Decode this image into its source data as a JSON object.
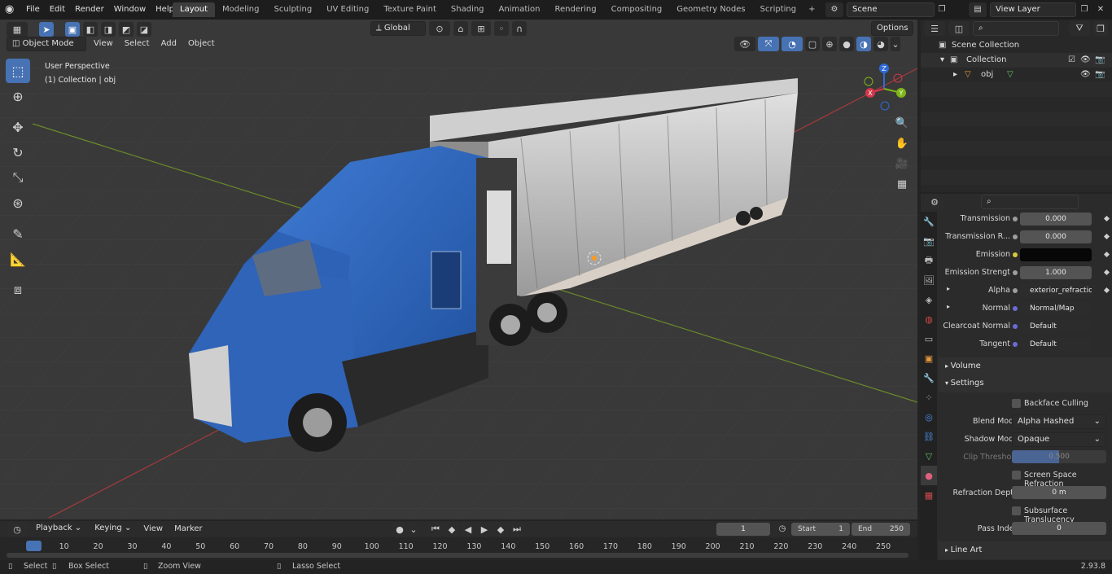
{
  "topbar": {
    "menus": [
      "File",
      "Edit",
      "Render",
      "Window",
      "Help"
    ],
    "workspaces": [
      "Layout",
      "Modeling",
      "Sculpting",
      "UV Editing",
      "Texture Paint",
      "Shading",
      "Animation",
      "Rendering",
      "Compositing",
      "Geometry Nodes",
      "Scripting"
    ],
    "active_workspace": "Layout",
    "add_workspace": "+",
    "scene": "Scene",
    "view_layer": "View Layer"
  },
  "viewport": {
    "mode": "Object Mode",
    "menus": [
      "View",
      "Select",
      "Add",
      "Object"
    ],
    "transform_orientation": "Global",
    "options_label": "Options",
    "perspective_label": "User Perspective",
    "collection_label": "(1) Collection | obj",
    "gizmo": {
      "x": "X",
      "y": "Y",
      "z": "Z"
    }
  },
  "outliner": {
    "scene_collection": "Scene Collection",
    "collection": "Collection",
    "object": "obj"
  },
  "properties": {
    "rows": [
      {
        "label": "Transmission",
        "value": "0.000"
      },
      {
        "label": "Transmission R...",
        "value": "0.000"
      },
      {
        "label": "Emission",
        "value": ""
      },
      {
        "label": "Emission Strengt",
        "value": "1.000"
      },
      {
        "label": "Alpha",
        "value": "exterior_refraction_i..."
      },
      {
        "label": "Normal",
        "value": "Normal/Map"
      },
      {
        "label": "Clearcoat Normal",
        "value": "Default"
      },
      {
        "label": "Tangent",
        "value": "Default"
      }
    ],
    "volume_label": "Volume",
    "settings_label": "Settings",
    "backface_culling": "Backface Culling",
    "blend_mode_label": "Blend Mode",
    "blend_mode": "Alpha Hashed",
    "shadow_mode_label": "Shadow Mode",
    "shadow_mode": "Opaque",
    "clip_threshold_label": "Clip Threshold",
    "clip_threshold": "0.500",
    "ssr_label": "Screen Space Refraction",
    "refraction_depth_label": "Refraction Depth",
    "refraction_depth": "0 m",
    "subsurface_label": "Subsurface Translucency",
    "pass_index_label": "Pass Index",
    "pass_index": "0",
    "line_art_label": "Line Art"
  },
  "timeline": {
    "menus": [
      "Playback",
      "Keying",
      "View",
      "Marker"
    ],
    "current_frame": "1",
    "start_label": "Start",
    "start": "1",
    "end_label": "End",
    "end": "250",
    "ticks": [
      "1",
      "10",
      "20",
      "30",
      "40",
      "50",
      "60",
      "70",
      "80",
      "90",
      "100",
      "110",
      "120",
      "130",
      "140",
      "150",
      "160",
      "170",
      "180",
      "190",
      "200",
      "210",
      "220",
      "230",
      "240",
      "250"
    ]
  },
  "statusbar": {
    "select": "Select",
    "box_select": "Box Select",
    "zoom_view": "Zoom View",
    "lasso_select": "Lasso Select",
    "version": "2.93.8"
  },
  "colors": {
    "accent": "#4772b3",
    "truck_blue": "#2f64b8",
    "grid_x": "#a83a3a",
    "grid_y": "#6a8a2a"
  }
}
